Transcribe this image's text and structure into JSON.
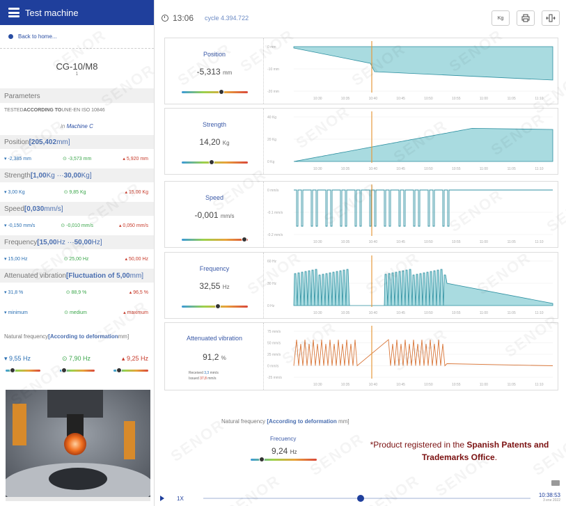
{
  "sidebar": {
    "brand": "Test machine",
    "back_label": "Back to home...",
    "machine_title": "CG-10/M8",
    "machine_sub": "1",
    "parameters_label": "Parameters",
    "tested_prefix": "TESTED ",
    "tested_bold": "ACCORDING TO",
    "tested_std": " UNE-EN ISO 10846",
    "in_prefix": "in ",
    "in_machine": "Machine C",
    "sections": [
      {
        "head": "Position ",
        "head_bold": "[205,402",
        "head_unit": " mm]",
        "min": "-2,385 mm",
        "avg": "-3,573 mm",
        "max": "5,920 mm"
      },
      {
        "head": "Strength ",
        "head_bold": "[1,00",
        "head_unit": " Kg ··· ",
        "head_bold2": "30,00",
        "head_unit2": " Kg]",
        "min": "3,00 Kg",
        "avg": "9,85 Kg",
        "max": "15,00 Kg"
      },
      {
        "head": "Speed ",
        "head_bold": "[0,030",
        "head_unit": " mm/s]",
        "min": "-0,150 mm/s",
        "avg": "-0,010 mm/s",
        "max": "0,050 mm/s"
      },
      {
        "head": "Frequency ",
        "head_bold": "[15,00",
        "head_unit": " Hz ··· ",
        "head_bold2": "50,00",
        "head_unit2": " Hz]",
        "min": "15,00 Hz",
        "avg": "25,00 Hz",
        "max": "50,00 Hz"
      },
      {
        "head": "Attenuated vibration ",
        "head_bold": "[Fluctuation of 5,00",
        "head_unit": " mm]",
        "min": "31,8 %",
        "avg": "88,9 %",
        "max": "96,5 %"
      }
    ],
    "levels": {
      "min": "minimum",
      "avg": "medium",
      "max": "maximum"
    },
    "nat_head": "Natural frequency ",
    "nat_head_bold": "[According to deformation",
    "nat_head_unit": " mm]",
    "nat_min": "9,55 Hz",
    "nat_avg": "7,90 Hz",
    "nat_max": "9,25 Hz"
  },
  "topbar": {
    "time": "13:06",
    "cycle": "cycle 4.394.722",
    "unit_button": "Kg"
  },
  "panels": [
    {
      "name": "Position",
      "value": "-5,313",
      "unit": "mm",
      "slider": 0.6,
      "yticks": [
        "0 mm",
        "-10 mm",
        "-20 mm"
      ]
    },
    {
      "name": "Strength",
      "value": "14,20",
      "unit": "Kg",
      "slider": 0.45,
      "yticks": [
        "40 Kg",
        "20 Kg",
        "0 Kg"
      ]
    },
    {
      "name": "Speed",
      "value": "-0,001",
      "unit": "mm/s",
      "slider": 0.95,
      "yticks": [
        "0 mm/s",
        "-0.1 mm/s",
        "-0.2 mm/s"
      ]
    },
    {
      "name": "Frequency",
      "value": "32,55",
      "unit": "Hz",
      "slider": 0.55,
      "yticks": [
        "60 Hz",
        "30 Hz",
        "0 Hz"
      ]
    },
    {
      "name": "Attenuated vibration",
      "value": "91,2",
      "unit": "%",
      "slider": null,
      "yticks": [
        "75 mm/s",
        "50 mm/s",
        "25 mm/s",
        "0 mm/s",
        "-25 mm/s"
      ],
      "received_label": "Received",
      "received_val": "3,3",
      "issued_label": "Issued",
      "issued_val": "37,8",
      "rate_unit": "mm/s"
    }
  ],
  "xticks": [
    "10:30",
    "10:35",
    "10:40",
    "10:45",
    "10:50",
    "10:55",
    "11:00",
    "11:05",
    "11:10"
  ],
  "natural": {
    "title": "Natural frequency ",
    "title_bold": "[According to deformation",
    "title_unit": " mm]",
    "name": "Frecuency",
    "value": "9,24",
    "unit": "Hz"
  },
  "registration": {
    "prefix": "*Product registered in the ",
    "bold": "Spanish Patents and Trademarks Office",
    "suffix": "."
  },
  "player": {
    "speed": "1X",
    "time": "10:38:53",
    "date": "3 ene 2022",
    "progress": 0.48
  },
  "watermark": "SENOR",
  "colors": {
    "brand": "#1f3f9c",
    "fill": "#a9dbe0",
    "line": "#2c8fa0",
    "cursor": "#e59a3c",
    "vibration": "#d9773a"
  }
}
